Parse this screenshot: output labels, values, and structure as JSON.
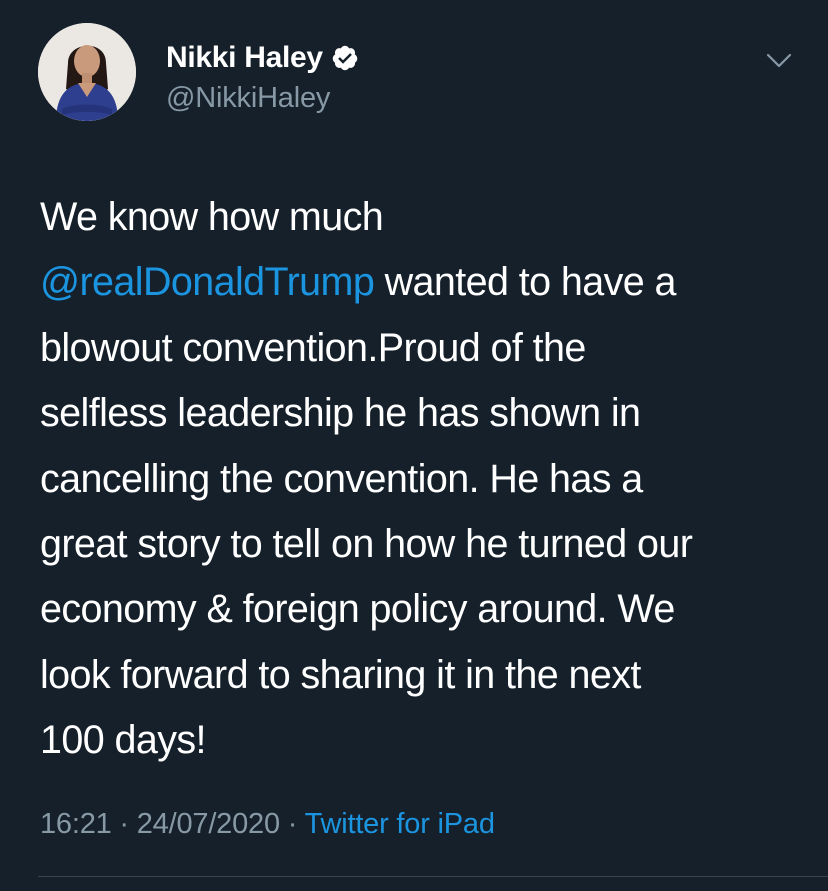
{
  "author": {
    "display_name": "Nikki Haley",
    "handle": "@NikkiHaley",
    "verified": true,
    "verified_icon": "verified-badge-icon"
  },
  "menu": {
    "icon": "chevron-down-icon"
  },
  "tweet": {
    "text_before": "We know how much\n",
    "mention": "@realDonaldTrump",
    "text_after": " wanted to have a\nblowout convention.Proud of the\nselfless leadership he has shown in\ncancelling the convention. He has a\ngreat story to tell on how he turned our\neconomy & foreign policy around. We\nlook forward to sharing it in the next\n100 days!"
  },
  "meta": {
    "time": "16:21",
    "separator_1": " · ",
    "date": "24/07/2020",
    "separator_2": " · ",
    "source": "Twitter for iPad"
  },
  "colors": {
    "background": "#15202b",
    "text": "#ffffff",
    "secondary": "#8899a6",
    "link": "#1b95e0",
    "divider": "#38444d"
  }
}
